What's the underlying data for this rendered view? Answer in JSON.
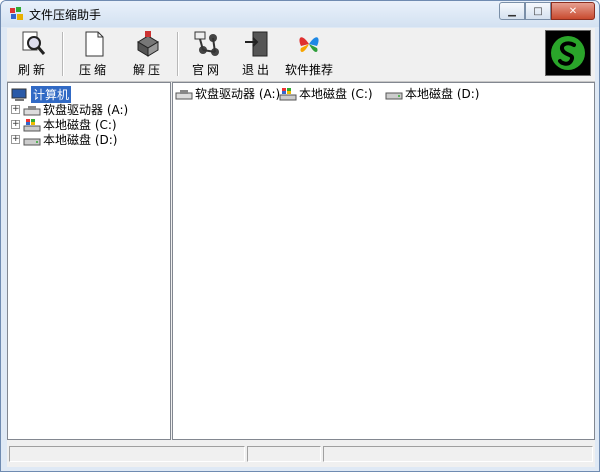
{
  "window": {
    "title": "文件压缩助手",
    "min_icon": "minimize-icon",
    "max_icon": "maximize-icon",
    "close_icon": "close-icon",
    "close_glyph": "✕"
  },
  "toolbar": {
    "refresh_label": "刷新",
    "compress_label": "压缩",
    "extract_label": "解压",
    "website_label": "官网",
    "exit_label": "退出",
    "recommend_label": "软件推荐"
  },
  "tree": {
    "root": "计算机",
    "items": [
      {
        "label": "软盘驱动器 (A:)",
        "icon": "floppy-drive-icon"
      },
      {
        "label": "本地磁盘 (C:)",
        "icon": "system-disk-icon"
      },
      {
        "label": "本地磁盘 (D:)",
        "icon": "disk-icon"
      }
    ]
  },
  "list": {
    "items": [
      {
        "label": "软盘驱动器 (A:)",
        "icon": "floppy-drive-icon"
      },
      {
        "label": "本地磁盘 (C:)",
        "icon": "system-disk-icon"
      },
      {
        "label": "本地磁盘 (D:)",
        "icon": "disk-icon"
      }
    ]
  },
  "colors": {
    "selection": "#316ac5",
    "logo_green": "#2aa52a"
  }
}
